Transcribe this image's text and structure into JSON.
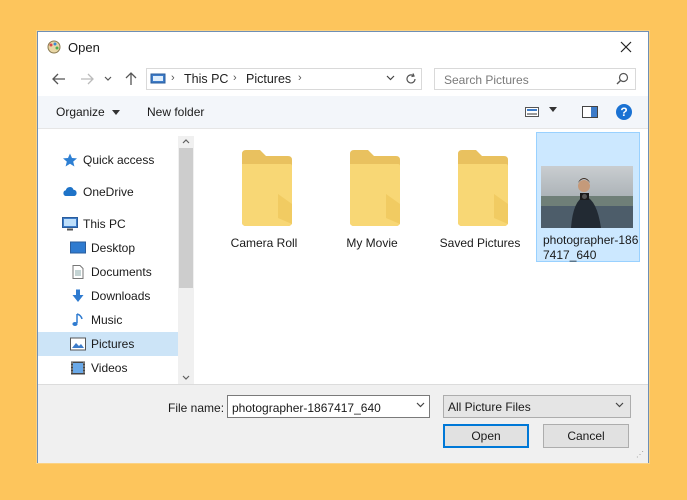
{
  "window": {
    "title": "Open"
  },
  "address": {
    "crumbs": [
      "This PC",
      "Pictures"
    ]
  },
  "search": {
    "placeholder": "Search Pictures"
  },
  "toolbar": {
    "organize_label": "Organize",
    "new_folder_label": "New folder",
    "help_label": "?"
  },
  "nav": {
    "items": [
      {
        "label": "Quick access",
        "icon": "star-icon"
      },
      {
        "label": "OneDrive",
        "icon": "cloud-icon"
      },
      {
        "label": "This PC",
        "icon": "computer-icon"
      },
      {
        "label": "Desktop",
        "icon": "desktop-icon"
      },
      {
        "label": "Documents",
        "icon": "document-icon"
      },
      {
        "label": "Downloads",
        "icon": "download-icon"
      },
      {
        "label": "Music",
        "icon": "music-icon"
      },
      {
        "label": "Pictures",
        "icon": "pictures-icon",
        "selected": true
      },
      {
        "label": "Videos",
        "icon": "video-icon"
      }
    ]
  },
  "files": [
    {
      "name": "Camera Roll",
      "type": "folder"
    },
    {
      "name": "My Movie",
      "type": "folder"
    },
    {
      "name": "Saved Pictures",
      "type": "folder"
    },
    {
      "name": "photographer-1867417_640",
      "type": "image",
      "selected": true
    }
  ],
  "bottom": {
    "file_name_label": "File name:",
    "file_name_value": "photographer-1867417_640",
    "filter_value": "All Picture Files",
    "open_label": "Open",
    "cancel_label": "Cancel"
  },
  "colors": {
    "accent": "#0078d7",
    "selection": "#cce8ff",
    "folder": "#f8d775",
    "background": "#FDC55C"
  }
}
